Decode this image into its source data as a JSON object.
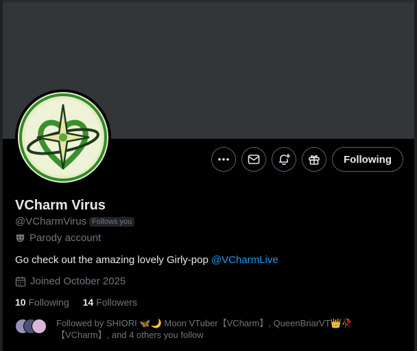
{
  "profile": {
    "display_name": "VCharm Virus",
    "handle": "@VCharmVirus",
    "follows_you_badge": "Follows you",
    "parody_label": "Parody account",
    "bio_text": "Go check out the amazing lovely Girly-pop ",
    "bio_mention": "@VCharmLive",
    "joined": "Joined October 2025",
    "following_count": "10",
    "following_label": "Following",
    "followers_count": "14",
    "followers_label": "Followers"
  },
  "actions": {
    "more_icon": "more-dots-icon",
    "message_icon": "envelope-icon",
    "notify_icon": "bell-plus-icon",
    "gift_icon": "gift-icon",
    "follow_label": "Following"
  },
  "followed_by": {
    "text_line1": "Followed by SHIORI 🦋🌙 Moon VTuber【VCharm】, QueenBriarVT👑🥀",
    "text_line2": "【VCharm】, and 4 others you follow",
    "avatar_colors": [
      "#9a8fb8",
      "#4b4f7a",
      "#d9b6d8"
    ]
  },
  "colors": {
    "accent": "#1d9bf0",
    "muted": "#71767b",
    "text": "#e7e9ea",
    "banner": "#333639"
  }
}
